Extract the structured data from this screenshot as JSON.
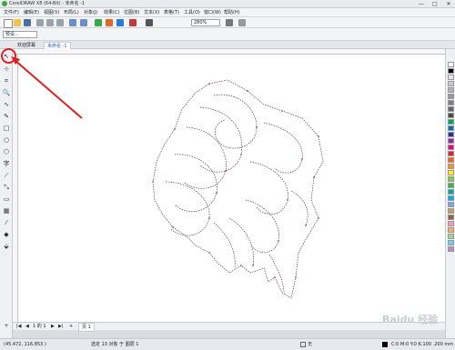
{
  "titlebar": {
    "title": "CorelDRAW X8 (64-Bit) - 未命名 -1",
    "min": "—",
    "max": "□",
    "close": "✕"
  },
  "menu": [
    "文件(F)",
    "编辑(E)",
    "视图(V)",
    "布局(L)",
    "对象(J)",
    "效果(C)",
    "位图(B)",
    "文本(X)",
    "表格(T)",
    "工具(O)",
    "窗口(W)",
    "帮助(H)"
  ],
  "toolbar": {
    "zoom": "280%"
  },
  "propbar": {
    "preset": "预设..."
  },
  "tabs": {
    "welcome": "欢迎屏幕",
    "doc": "未命名 -1"
  },
  "pagebar": {
    "pages": "1 的 1",
    "page_label": "页 1"
  },
  "status": {
    "coords": "(45.472, 116.853 )",
    "selection": "选定 13 对象 于 图层 1",
    "fill": "无",
    "outline": "C:0 M:0 Y:0 K:100 .200 mm"
  },
  "watermark": "Baidu 经验",
  "palette_colors": [
    "#ffffff",
    "#000000",
    "#e6e6e6",
    "#cccccc",
    "#b3b3b3",
    "#999999",
    "#808080",
    "#666666",
    "#4d4d4d",
    "#00a651",
    "#0072bc",
    "#2e3192",
    "#92278f",
    "#ec008c",
    "#ed1c24",
    "#f26522",
    "#f7941d",
    "#fff200",
    "#8dc63f",
    "#39b54a",
    "#00a99d",
    "#00aeef",
    "#7da7d9",
    "#c69c6d",
    "#8c6239",
    "#f49ac1",
    "#fbaf5d",
    "#a3d39c",
    "#6dcff6",
    "#bd8cbf"
  ],
  "tools": [
    "pick",
    "shape",
    "crop",
    "zoom",
    "freehand",
    "artistic-media",
    "rectangle",
    "ellipse",
    "polygon",
    "text",
    "parallel-dimension",
    "connector",
    "drop-shadow",
    "transparency",
    "eyedropper",
    "interactive-fill",
    "smart-fill"
  ]
}
